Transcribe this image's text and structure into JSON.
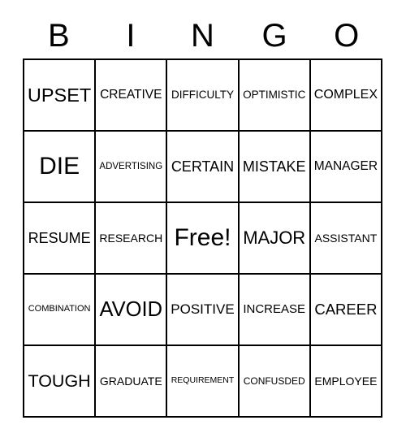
{
  "card": {
    "title": "BINGO",
    "header_letters": [
      "B",
      "I",
      "N",
      "G",
      "O"
    ],
    "free_space_label": "Free!",
    "grid": {
      "rows": 5,
      "columns": 5,
      "cells": [
        [
          "UPSET",
          "CREATIVE",
          "DIFFICULTY",
          "OPTIMISTIC",
          "COMPLEX"
        ],
        [
          "DIE",
          "ADVERTISING",
          "CERTAIN",
          "MISTAKE",
          "MANAGER"
        ],
        [
          "RESUME",
          "RESEARCH",
          "Free!",
          "MAJOR",
          "ASSISTANT"
        ],
        [
          "COMBINATION",
          "AVOID",
          "POSITIVE",
          "INCREASE",
          "CAREER"
        ],
        [
          "TOUGH",
          "GRADUATE",
          "REQUIREMENT",
          "CONFUSDED",
          "EMPLOYEE"
        ]
      ]
    },
    "colors": {
      "background": "#ffffff",
      "border": "#000000",
      "text": "#000000"
    }
  }
}
